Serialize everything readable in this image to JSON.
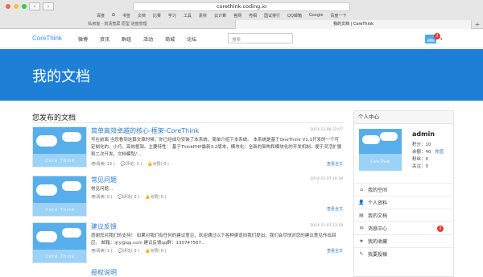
{
  "browser": {
    "url": "corethink.coding.io",
    "nav_back": "‹",
    "nav_fwd": "›",
    "bookmarks": [
      "百度",
      "Ω",
      "书签",
      "文档",
      "比赛",
      "学习",
      "工具",
      "素材",
      "云计算",
      "官网",
      "亮相",
      "国试排行",
      "QQ邮箱",
      "Google",
      "百度一下"
    ],
    "tabs": [
      "私房客 - 高清宽屏 原型 进度管理",
      "我的文档 | CoreThink"
    ],
    "active_tab": 1,
    "new_tab": "+"
  },
  "site": {
    "logo": "CoreThink",
    "menu": [
      "微博",
      "资讯",
      "群组",
      "活动",
      "商城",
      "论坛"
    ],
    "search_placeholder": "搜索",
    "notif_count": "2"
  },
  "banner": {
    "title": "我的文档"
  },
  "main": {
    "section_title": "您发布的文档",
    "posts": [
      {
        "title": "简单高效卓越的核心-框架-CoreThink",
        "date": "2014-12-08 22:07",
        "body": "写在前面 当您看到这篇文章时候，你已经成功安装了本系统，简单介绍下本系统。 本系统是基于OneThink V1.1开发的一个可定制化的、小巧、高效框架。主要特性： 基于ThinkPHP最新3.2版本，模块化：全新的架构和模块化的开发机制，便于灵活扩展和二次开发。文档模型/...",
        "views": "阅读( 15 )",
        "comments": "评论( 1 )",
        "likes": "点赞( 0 )",
        "more": "查看全文"
      },
      {
        "title": "常见问题",
        "date": "2014-11-07 16:38",
        "body": "常见问题...",
        "views": "阅读( 0 )",
        "comments": "评论( 0 )",
        "likes": "点赞( 0 )",
        "more": "查看全文"
      },
      {
        "title": "建议反馈",
        "date": "2014-11-07 13:18",
        "body": "感谢您对我们的支持！ 如果对我们有任何的建议意见，欢迎通过以下各种渠道向我们提出，我们会尽快对您的建议意见作出回应。 邮箱：ijry@qq.com 建议反馈qq群：130747567...",
        "views": "阅读( 1 )",
        "comments": "评论( 0 )",
        "likes": "点赞( 0 )",
        "more": "查看全文"
      },
      {
        "title": "授权说明",
        "date": "",
        "body": "",
        "views": "",
        "comments": "",
        "likes": "",
        "more": ""
      }
    ],
    "thumb_caption": "Core Think"
  },
  "sidebar": {
    "title": "个人中心",
    "username": "admin",
    "points": "积分：10",
    "balance": "余额：¥0",
    "fans": "粉丝：0",
    "follow": "关注：0",
    "recharge": "充值",
    "avatar_caption": "Core Think",
    "items": [
      {
        "label": "我的空间",
        "icon": "home-icon",
        "glyph": "⌂"
      },
      {
        "label": "个人资料",
        "icon": "user-icon",
        "glyph": "👤"
      },
      {
        "label": "我的文档",
        "icon": "document-icon",
        "glyph": "▤"
      },
      {
        "label": "消息中心",
        "icon": "message-icon",
        "glyph": "✉",
        "badge": "2"
      },
      {
        "label": "我的收藏",
        "icon": "star-icon",
        "glyph": "★"
      },
      {
        "label": "我要投稿",
        "icon": "edit-icon",
        "glyph": "✎"
      }
    ]
  }
}
